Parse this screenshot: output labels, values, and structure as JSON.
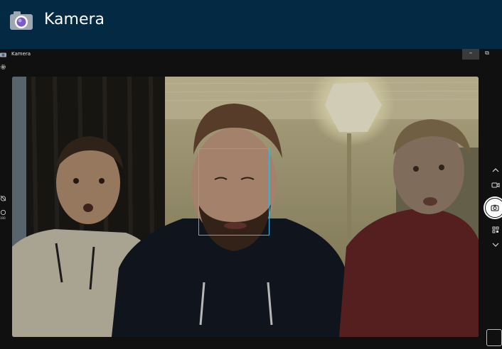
{
  "banner": {
    "title": "Kamera",
    "bg_color": "#032a42",
    "icon": "camera-icon"
  },
  "window": {
    "title": "Kamera",
    "controls": {
      "minimize": "–",
      "restore": "⧉"
    }
  },
  "left_toolbar": {
    "items": [
      "camera-small-icon",
      "gear-icon",
      "timer-off-icon",
      "hdr-icon"
    ],
    "hdr_label": "100"
  },
  "right_toolbar": {
    "items": [
      "chevron-up-icon",
      "video-mode-icon",
      "photo-shutter-icon",
      "qr-code-icon",
      "chevron-down-icon"
    ]
  },
  "viewfinder": {
    "face_detection_color": "#3bb8e8"
  }
}
